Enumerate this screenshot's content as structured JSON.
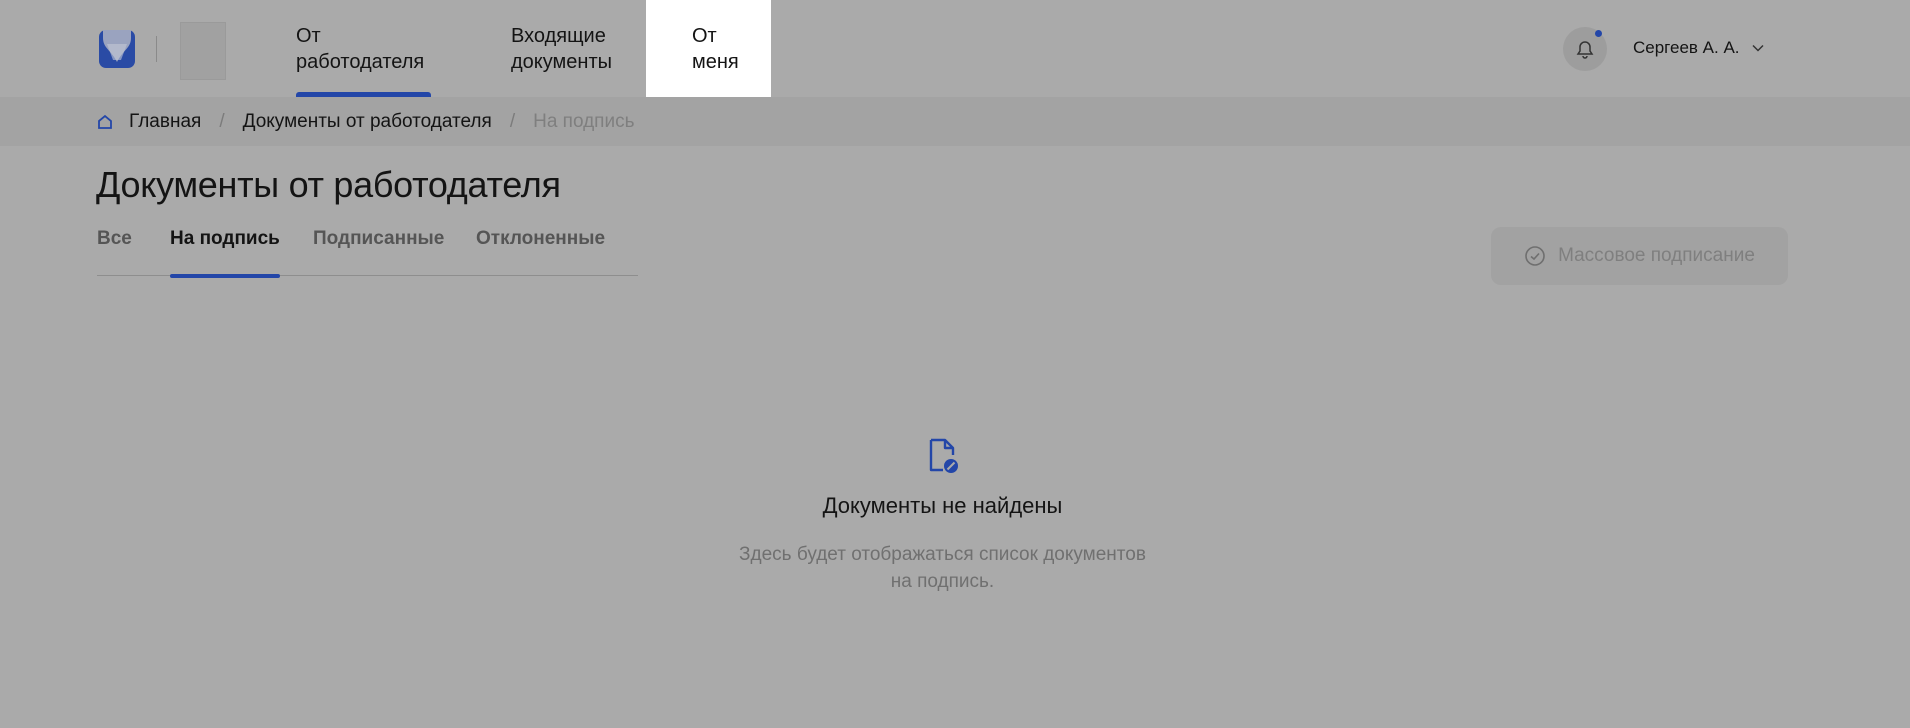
{
  "header": {
    "nav": {
      "employer_label": "От\nработодателя",
      "incoming_label": "Входящие\nдокументы",
      "mine_label": "От\nменя"
    },
    "user_name": "Сергеев А. А."
  },
  "breadcrumb": {
    "home_label": "Главная",
    "section_label": "Документы от работодателя",
    "current_label": "На подпись"
  },
  "page": {
    "title": "Документы от работодателя"
  },
  "tabs": {
    "all": "Все",
    "to_sign": "На подпись",
    "signed": "Подписанные",
    "rejected": "Отклоненные"
  },
  "actions": {
    "mass_sign_label": "Массовое подписание"
  },
  "empty_state": {
    "title": "Документы не найдены",
    "description": "Здесь будет отображаться список документов на подпись."
  },
  "colors": {
    "accent": "#2346a8",
    "overlay_background": "#aaaaaa"
  },
  "icons": {
    "logo": "company-logo",
    "home": "home-icon",
    "bell": "bell-icon",
    "chevron": "chevron-down-icon",
    "check": "check-circle-icon",
    "empty": "document-blocked-icon"
  }
}
